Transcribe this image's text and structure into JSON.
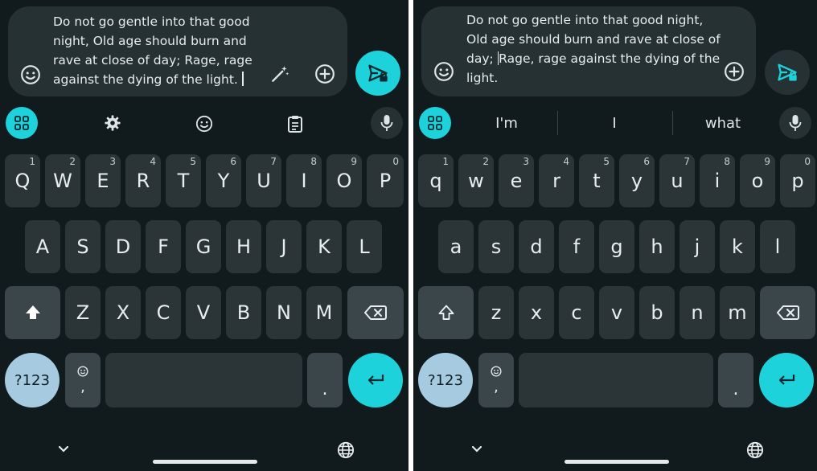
{
  "left": {
    "compose_lines": [
      "Do not go gentle into that good",
      "night, Old age should burn and",
      "rave at close of day; Rage, rage",
      "against the dying of the light."
    ],
    "toolbar_icons": [
      "apps-grid-icon",
      "settings-gear-icon",
      "emoji-icon",
      "clipboard-icon",
      "microphone-icon"
    ],
    "row1": [
      {
        "k": "Q",
        "n": "1"
      },
      {
        "k": "W",
        "n": "2"
      },
      {
        "k": "E",
        "n": "3"
      },
      {
        "k": "R",
        "n": "4"
      },
      {
        "k": "T",
        "n": "5"
      },
      {
        "k": "Y",
        "n": "6"
      },
      {
        "k": "U",
        "n": "7"
      },
      {
        "k": "I",
        "n": "8"
      },
      {
        "k": "O",
        "n": "9"
      },
      {
        "k": "P",
        "n": "0"
      }
    ],
    "row2": [
      "A",
      "S",
      "D",
      "F",
      "G",
      "H",
      "J",
      "K",
      "L"
    ],
    "row3": [
      "Z",
      "X",
      "C",
      "V",
      "B",
      "N",
      "M"
    ],
    "symbols_label": "?123",
    "comma_label": ",",
    "period_label": ".",
    "shift_state": "shift-active"
  },
  "right": {
    "compose_lines": [
      "Do not go gentle into that good night,",
      "Old age should burn and rave at close of",
      "day; Rage, rage against the dying of the",
      "light."
    ],
    "caret_line": 2,
    "suggestions": [
      "I'm",
      "I",
      "what"
    ],
    "row1": [
      {
        "k": "q",
        "n": "1"
      },
      {
        "k": "w",
        "n": "2"
      },
      {
        "k": "e",
        "n": "3"
      },
      {
        "k": "r",
        "n": "4"
      },
      {
        "k": "t",
        "n": "5"
      },
      {
        "k": "y",
        "n": "6"
      },
      {
        "k": "u",
        "n": "7"
      },
      {
        "k": "i",
        "n": "8"
      },
      {
        "k": "o",
        "n": "9"
      },
      {
        "k": "p",
        "n": "0"
      }
    ],
    "row2": [
      "a",
      "s",
      "d",
      "f",
      "g",
      "h",
      "j",
      "k",
      "l"
    ],
    "row3": [
      "z",
      "x",
      "c",
      "v",
      "b",
      "n",
      "m"
    ],
    "symbols_label": "?123",
    "comma_label": ",",
    "period_label": ".",
    "shift_state": "shift-off"
  },
  "colors": {
    "background": "#111a1c",
    "compose_bg": "#263134",
    "key_bg": "#2b3538",
    "func_key_bg": "#3a4649",
    "accent_cyan": "#1ed2dc",
    "symbols_key": "#a6cbe0",
    "text": "#e8edef"
  }
}
